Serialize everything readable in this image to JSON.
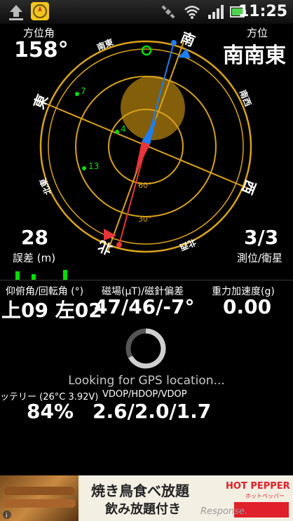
{
  "status_bar": {
    "time": "11:25"
  },
  "compass": {
    "heading_label": "方位角",
    "heading_value": "158°",
    "direction_label": "方位",
    "direction_value": "南南東",
    "error_value": "28",
    "error_label": "誤差 (m)",
    "sats_value": "3/3",
    "sats_label": "測位/衛星",
    "cardinals": {
      "north": "北",
      "south": "南",
      "east": "東",
      "west": "西"
    },
    "intercardinals": {
      "se": "南東",
      "sw": "南西",
      "nw": "北西",
      "ne": "北東"
    },
    "ring_labels": {
      "r60": "60°",
      "r30": "30°"
    },
    "satellites": [
      {
        "id": "7",
        "color": "#00e000"
      },
      {
        "id": "4",
        "color": "#00e000"
      },
      {
        "id": "13",
        "color": "#00e000"
      }
    ],
    "colors": {
      "ring": "#d9a21a",
      "needle_north": "#e8343a",
      "needle_south": "#1e7df0",
      "sun": "#b9860f"
    }
  },
  "sensors": {
    "tilt_label": "仰俯角/回転角 (°)",
    "tilt_value": "上09 左02",
    "magnetic_label": "磁場(μT)/磁針偏差",
    "magnetic_value": "47/46/-7°",
    "gravity_label": "重力加速度(g)",
    "gravity_value": "0.00"
  },
  "gps": {
    "status_text": "Looking for GPS location...",
    "battery_label": "ッテリー (26°C 3.92V)",
    "battery_value": "84%",
    "dop_label": "VDOP/HDOP/VDOP",
    "dop_value": "2.6/2.0/1.7"
  },
  "ad": {
    "line1": "焼き鳥食べ放題",
    "line2": "飲み放題付き",
    "brand": "HOT PEPPER",
    "sub": "ホットペッパー",
    "watermark": "Response."
  }
}
